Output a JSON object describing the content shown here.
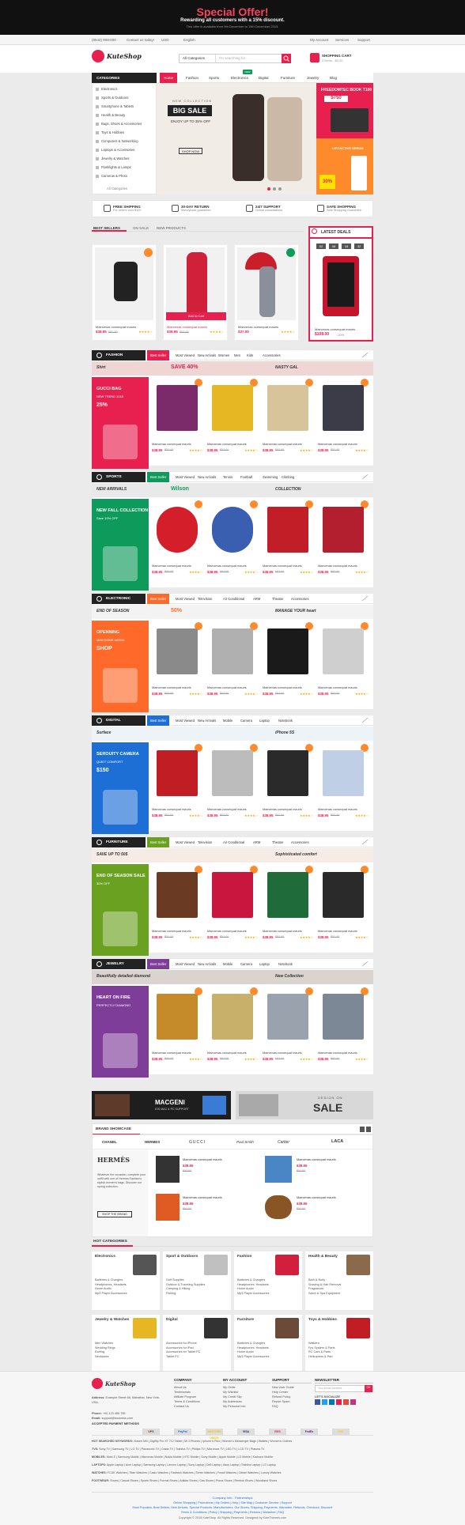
{
  "topbar": {
    "title": "Special Offer!",
    "subtitle": "Rewarding all customers with a 15% discount.",
    "note": "This offer is available from 9th December to 19th December 2015."
  },
  "utilbar": {
    "phone": "(8642) 808-000",
    "contact": "Contact us today!",
    "currency": "USD",
    "language": "English",
    "account": "My Account",
    "services": "Services",
    "support": "Support"
  },
  "header": {
    "brand": "KuteShop",
    "search_category": "All Categories",
    "search_placeholder": "I'm searching for...",
    "cart_title": "SHOPPING CART",
    "cart_summary": "2 items - $0.00"
  },
  "nav": {
    "categories_label": "CATEGORIES",
    "items": [
      "Home",
      "Fashion",
      "Sports",
      "Electronics",
      "Digital",
      "Furniture",
      "Jewelry",
      "Blog"
    ],
    "new_badge": "NEW"
  },
  "sidebar": {
    "items": [
      "Electronics",
      "Sports & Outdoors",
      "Smartphone & Tablets",
      "Health & Beauty",
      "Bags, Shoes & Accessories",
      "Toys & Hobbies",
      "Computers & Networking",
      "Laptops & Accessories",
      "Jewelry & Watches",
      "Flashlights & Lamps",
      "Cameras & Photo"
    ],
    "all": "All Categories"
  },
  "hero": {
    "tag": "NEW COLLECTION",
    "title": "BIG SALE",
    "subtitle": "ENJOY UP TO 35% OFF",
    "button": "SHOP NOW"
  },
  "promos": {
    "p1_label": "FREEDOMTEC BOOK T100",
    "p1_price": "$750",
    "p2_label": "LIPOACTIVE SERUM",
    "p2_discount": "30%"
  },
  "features": [
    {
      "title": "FREE SHIPPING",
      "sub": "For orders over $100"
    },
    {
      "title": "30-DAY RETURN",
      "sub": "Moneyback guarantee"
    },
    {
      "title": "24/7 SUPPORT",
      "sub": "Online consultations"
    },
    {
      "title": "SAFE SHOPPING",
      "sub": "Safe Shopping Guarantee"
    }
  ],
  "bestsellers": {
    "tabs": [
      "BEST SELLERS",
      "ON SALE",
      "NEW PRODUCTS"
    ],
    "deals_title": "LATEST DEALS",
    "countdown": [
      "02",
      "08",
      "18",
      "32"
    ],
    "products": [
      {
        "name": "Maecenas consequat mauris",
        "price": "$38.95",
        "old": "$52.00",
        "stars": "★★★★☆"
      },
      {
        "name": "Maecenas consequat mauris",
        "price": "$38.95",
        "old": "$52.00",
        "stars": "★★★★☆"
      },
      {
        "name": "Maecenas consequat mauris",
        "price": "$37.00",
        "old": "",
        "stars": "★★★★☆"
      }
    ],
    "deal": {
      "name": "Maecenas consequat mauris",
      "price": "$108.00",
      "discount": "-20%"
    },
    "add_to_cart": "Add to Cart"
  },
  "sections": [
    {
      "title": "FASHION",
      "tabs": [
        "Best Seller",
        "Most Viewed",
        "New Arrivals",
        "Women",
        "Men",
        "Kids",
        "Accessories"
      ],
      "banner_left": "Shirt",
      "banner_mid": "SAVE 40%",
      "banner_right": "NASTY GAL",
      "side_title": "GUCCI BAG",
      "side_sub": "NEW TREND 2015",
      "side_tag": "25%",
      "color": "#e8204f"
    },
    {
      "title": "SPORTS",
      "tabs": [
        "Best Seller",
        "Most Viewed",
        "New Arrivals",
        "Tennis",
        "Football",
        "Swimming",
        "Climbing"
      ],
      "banner_left": "NEW ARRIVALS",
      "banner_mid": "Wilson",
      "banner_right": "COLLECTION",
      "side_title": "NEW FALL COLLECTION",
      "side_sub": "Save 10% OFF",
      "side_tag": "",
      "color": "#0e9a5b"
    },
    {
      "title": "ELECTRONIC",
      "tabs": [
        "Best Seller",
        "Most Viewed",
        "Television",
        "Air Conditional",
        "ARM",
        "Theater",
        "Accessories"
      ],
      "banner_left": "END OF SEASON",
      "banner_mid": "50%",
      "banner_right": "MANAGE YOUR heart",
      "side_title": "OPENNING",
      "side_sub": "MINI HOME MEDIA",
      "side_tag": "SHOP",
      "color": "#ff6a2b"
    },
    {
      "title": "DIGITAL",
      "tabs": [
        "Best Seller",
        "Most Viewed",
        "New Arrivals",
        "Mobile",
        "Camera",
        "Laptop",
        "Notebook"
      ],
      "banner_left": "Surface",
      "banner_mid": "",
      "banner_right": "iPhone 5S",
      "side_title": "SEROUITY CAMERA",
      "side_sub": "QUIET COMFORT",
      "side_tag": "$150",
      "color": "#1d6fd6"
    },
    {
      "title": "FURNITURE",
      "tabs": [
        "Best Seller",
        "Most Viewed",
        "Television",
        "Air Conditional",
        "ARM",
        "Theater",
        "Accessories"
      ],
      "banner_left": "SAVE UP TO 50$",
      "banner_mid": "",
      "banner_right": "Sophisticated comfort",
      "side_title": "END OF SEASON SALE",
      "side_sub": "30% OFF",
      "side_tag": "",
      "color": "#6aa121"
    },
    {
      "title": "JEWELRY",
      "tabs": [
        "Best Seller",
        "Most Viewed",
        "New Arrivals",
        "Mobile",
        "Camera",
        "Laptop",
        "Notebook"
      ],
      "banner_left": "Beautifully detailed diamond",
      "banner_mid": "",
      "banner_right": "New Collection",
      "side_title": "HEART ON FIRE",
      "side_sub": "PERFECTLY DIAMOND",
      "side_tag": "",
      "color": "#7f3d9a"
    }
  ],
  "section_product": {
    "name": "Maecenas consequat mauris",
    "price": "$38.95",
    "old": "$52.00",
    "stars": "★★★★☆"
  },
  "bottom_banners": {
    "left": "MACGENI",
    "left_sub": "IOS MAC & PC SUPPORT",
    "right_top": "DESIGN ON",
    "right": "SALE"
  },
  "brand_showcase": {
    "title": "BRAND SHOWCASE",
    "brands": [
      "CHANEL",
      "HERMES",
      "GUCCI",
      "Paul Smith",
      "Cartier",
      "LACA"
    ],
    "feature_name": "HERMÈS",
    "feature_text": "Whatever the occasion, complete your outfit with one of Hermes Fashion's stylish women's bags. Discover our spring collection.",
    "feature_button": "SHOP THE BRAND",
    "items": [
      {
        "name": "Maecenas consequat mauris",
        "price": "$38.95",
        "old": "$52.00"
      },
      {
        "name": "Maecenas consequat mauris",
        "price": "$38.95",
        "old": "$52.00"
      },
      {
        "name": "Maecenas consequat mauris",
        "price": "$38.95",
        "old": "$52.00"
      },
      {
        "name": "Maecenas consequat mauris",
        "price": "$38.95",
        "old": "$52.00"
      }
    ]
  },
  "hot_categories": {
    "title": "HOT CATEGORIES",
    "cats": [
      {
        "title": "Electronics",
        "items": [
          "Batteries & Chargers",
          "Headphones, Headsets",
          "Home Audio",
          "Mp3 Player Accessories"
        ]
      },
      {
        "title": "Sport & Outdoors",
        "items": [
          "Golf Supplies",
          "Outdoor & Traveling Supplies",
          "Camping & Hiking",
          "Fishing"
        ]
      },
      {
        "title": "Fashion",
        "items": [
          "Batteries & Chargers",
          "Headphones, Headsets",
          "Home Audio",
          "Mp3 Player Accessories"
        ]
      },
      {
        "title": "Health & Beauty",
        "items": [
          "Bath & Body",
          "Shaving & Hair Removal",
          "Fragrances",
          "Salon & Spa Equipment"
        ]
      },
      {
        "title": "Jewelry & Watches",
        "items": [
          "Men Watches",
          "Wedding Rings",
          "Earring",
          "Necklaces"
        ]
      },
      {
        "title": "Digital",
        "items": [
          "Accessories for iPhone",
          "Accessories for iPad",
          "Accessories for Tablet PC",
          "Tablet PC"
        ]
      },
      {
        "title": "Furniture",
        "items": [
          "Batteries & Chargers",
          "Headphones, Headsets",
          "Home Audio",
          "Mp3 Player Accessories"
        ]
      },
      {
        "title": "Toys & Hobbies",
        "items": [
          "Walkera",
          "Fpv System & Parts",
          "RC Cars & Parts",
          "Helicopters & Part"
        ]
      }
    ]
  },
  "footer": {
    "address_label": "Address:",
    "address": "Example Street 68, Mahattan, New York, USA.",
    "phone_label": "Phone:",
    "phone": "+00 123 456 789",
    "email_label": "Email:",
    "email": "support@business.com",
    "company": {
      "title": "COMPANY",
      "links": [
        "About Us",
        "Testimonials",
        "Affiliate Program",
        "Terms & Conditions",
        "Contact Us"
      ]
    },
    "account": {
      "title": "MY ACCOUNT",
      "links": [
        "My Order",
        "My Wishlist",
        "My Credit Slip",
        "My Addresses",
        "My Personal Info"
      ]
    },
    "support": {
      "title": "SUPPORT",
      "links": [
        "New User Guide",
        "Help Center",
        "Refund Policy",
        "Report Spam",
        "FAQ"
      ]
    },
    "newsletter": {
      "title": "NEWSLETTER",
      "placeholder": "Your Email Address",
      "button": "OK",
      "social": "LET'S SOCIALIZE"
    },
    "payment_label": "ACCEPTED PAYMENT METHODS",
    "payments": [
      "UPS",
      "PayPal",
      "WESTERN UNION",
      "VISA",
      "EMS",
      "FedEx",
      "DHL"
    ],
    "keywords": [
      {
        "label": "HOT SEARCHED KEYWORDS:",
        "text": "Xiaomi Mi3 | Digiflip Pro XT 712 Tablet | Mi 3 Phones | Iphone 6 Plus | Women's Messenger Bags | Wallets | Women's Clothes"
      },
      {
        "label": "TVS:",
        "text": "Sony TV | Samsung TV | LG TV | Panasonic TV | Onida TV | Toshiba TV | Philips TV | Micromax TV | LED TV | LCD TV | Plasma TV"
      },
      {
        "label": "MOBILES:",
        "text": "Moto E | Samsung Mobile | Micromax Mobile | Nokia Mobile | HTC Mobile | Sony Mobile | Apple Mobile | LG Mobile | Karbonn Mobile"
      },
      {
        "label": "LAPTOPS:",
        "text": "Apple Laptop | Acer Laptop | Samsung Laptop | Lenovo Laptop | Sony Laptop | Dell Laptop | Asus Laptop | Toshiba Laptop | LG Laptop"
      },
      {
        "label": "WATCHES:",
        "text": "FCUK Watches | Titan Watches | Casio Watches | Fastrack Watches | Timex Watches | Fossil Watches | Diesel Watches | Luxury Watches"
      },
      {
        "label": "FOOTWEAR:",
        "text": "Shoes | Casual Shoes | Sports Shoes | Formal Shoes | Adidas Shoes | Gas Shoes | Puma Shoes | Reebok Shoes | Woodland Shoes"
      }
    ],
    "bottom_links_1": "Company Info - Partnerships",
    "bottom_links_2": "Online Shopping | Promotions | My Orders | Help | Site Map | Customer Service | Support",
    "bottom_links_3": "Most Populars, Best Sellers, New Arrivals, Special Products, Manufacturers, Our Stores, Shipping, Payments, Warantee, Refunds, Checkout, Discount",
    "bottom_links_4": "Terms & Conditions | Policy | Shipping | Payments | Returns | Warantee | FAQ",
    "copyright": "Copyright © 2015 KuteShop. All Rights Reserved. Designed by KuteThemes.com"
  },
  "colors": {
    "accent": "#e8204f",
    "dark": "#222222",
    "orange": "#ff8a2b"
  }
}
